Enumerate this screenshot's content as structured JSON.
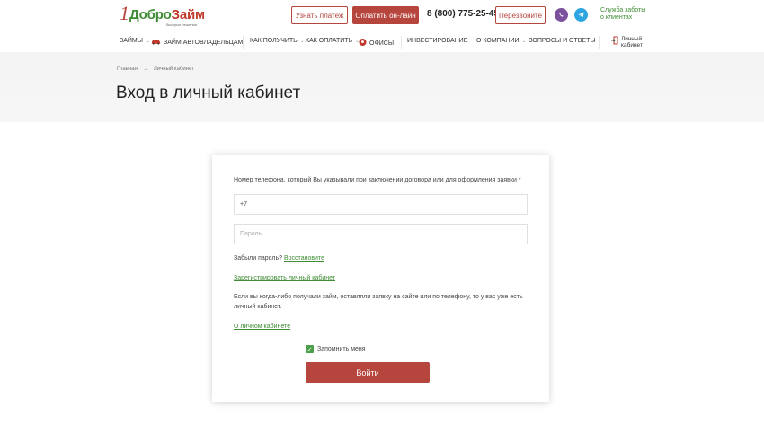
{
  "header": {
    "logo_one": "1",
    "logo_name_a": "Добро",
    "logo_name_b": "Займ",
    "logo_tagline": "быстрые решения",
    "check_payment": "Узнать платеж",
    "pay_online": "Оплатить он-лайн",
    "phone": "8 (800) 775-25-45",
    "callback": "Перезвоните",
    "support_line1": "Служба заботы",
    "support_line2": "о клиентах",
    "colors": {
      "brand_red": "#b5453d",
      "brand_green": "#3f8d35",
      "viber": "#7b519d",
      "telegram": "#2ca5e0"
    }
  },
  "nav": {
    "items": [
      {
        "label": "Займы"
      },
      {
        "label": "Займ автовладельцам"
      },
      {
        "label": "Как получить"
      },
      {
        "label": "Как оплатить"
      },
      {
        "label": "Офисы"
      },
      {
        "label": "Инвестирование"
      },
      {
        "label": "О компании"
      },
      {
        "label": "Вопросы и ответы"
      }
    ],
    "cabinet_line1": "Личный",
    "cabinet_line2": "кабинет"
  },
  "breadcrumb": {
    "home": "Главная",
    "sep": "→",
    "current": "Личный кабинет"
  },
  "page_title": "Вход в личный кабинет",
  "form": {
    "phone_label": "Номер телефона, который Вы указывали при заключении договора или для оформления заявки *",
    "phone_value": "+7",
    "password_placeholder": "Пароль",
    "forgot_text": "Забыли пароль?",
    "restore_link": "Восстановите",
    "register_link": "Зарегистрировать личный кабинет",
    "info_text": "Если вы когда-либо получали займ, оставляли заявку на сайте или по телефону, то у вас уже есть личный кабинет.",
    "about_link": "О личном кабинете",
    "remember_label": "Запомнить меня",
    "remember_checked": true,
    "submit_label": "Войти"
  }
}
